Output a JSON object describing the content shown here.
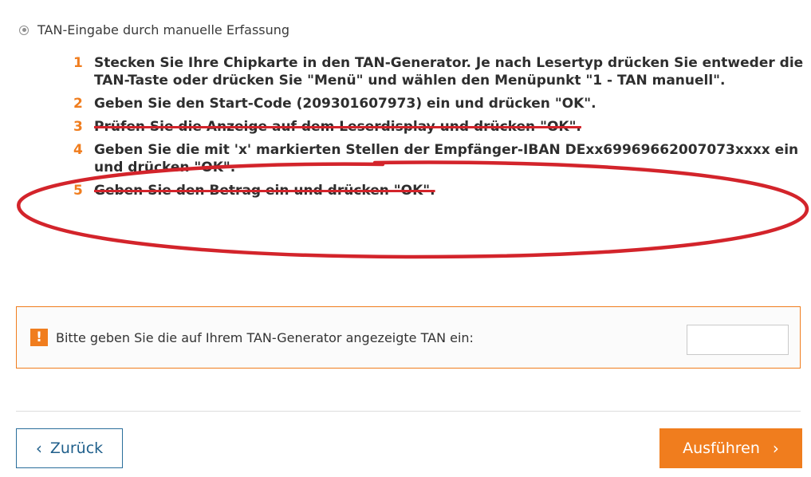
{
  "method": {
    "label": "TAN-Eingabe durch manuelle Erfassung"
  },
  "steps": [
    {
      "num": "1",
      "text": "Stecken Sie Ihre Chipkarte in den TAN-Generator. Je nach Lesertyp drücken Sie entweder die TAN-Taste oder drücken Sie \"Menü\" und wählen den Menüpunkt \"1 - TAN manuell\"."
    },
    {
      "num": "2",
      "text": "Geben Sie den Start-Code (209301607973) ein und drücken \"OK\"."
    },
    {
      "num": "3",
      "text": "Prüfen Sie die Anzeige auf dem Leserdisplay und drücken \"OK\"."
    },
    {
      "num": "4",
      "text": "Geben Sie die mit 'x' markierten Stellen der Empfänger-IBAN DExx69969662007073xxxx ein und drücken \"OK\"."
    },
    {
      "num": "5",
      "text": "Geben Sie den Betrag ein und drücken \"OK\"."
    }
  ],
  "tan": {
    "icon": "!",
    "label": "Bitte geben Sie die auf Ihrem TAN-Generator angezeigte TAN ein:",
    "value": "",
    "placeholder": ""
  },
  "buttons": {
    "back_chevron": "‹",
    "back_label": "Zurück",
    "execute_label": "Ausführen",
    "execute_chevron": "›"
  },
  "colors": {
    "accent": "#f07d1e",
    "link": "#1f5f8b",
    "annotation": "#d3242b"
  }
}
